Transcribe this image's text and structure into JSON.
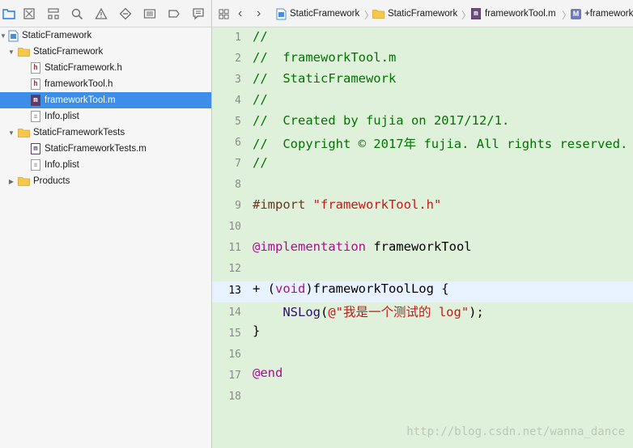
{
  "navigator": {
    "toolbar_icons": [
      "folder-icon",
      "source-control-icon",
      "hierarchy-icon",
      "search-icon",
      "warning-icon",
      "test-icon",
      "debug-icon",
      "breakpoint-icon",
      "report-icon"
    ],
    "tree": [
      {
        "label": "StaticFramework",
        "kind": "project",
        "expanded": true
      },
      {
        "label": "StaticFramework",
        "kind": "folder",
        "expanded": true
      },
      {
        "label": "StaticFramework.h",
        "kind": "h"
      },
      {
        "label": "frameworkTool.h",
        "kind": "h"
      },
      {
        "label": "frameworkTool.m",
        "kind": "m",
        "selected": true
      },
      {
        "label": "Info.plist",
        "kind": "plist"
      },
      {
        "label": "StaticFrameworkTests",
        "kind": "folder",
        "expanded": true
      },
      {
        "label": "StaticFrameworkTests.m",
        "kind": "m"
      },
      {
        "label": "Info.plist",
        "kind": "plist"
      },
      {
        "label": "Products",
        "kind": "folder",
        "expanded": false
      }
    ]
  },
  "jumpbar": {
    "items": [
      "StaticFramework",
      "StaticFramework",
      "frameworkTool.m",
      "+frameworkT"
    ]
  },
  "editor": {
    "current_line": 13,
    "line_numbers": [
      "1",
      "2",
      "3",
      "4",
      "5",
      "6",
      "7",
      "8",
      "9",
      "10",
      "11",
      "12",
      "13",
      "14",
      "15",
      "16",
      "17",
      "18"
    ],
    "lines": {
      "l1": "//",
      "l2": "//  frameworkTool.m",
      "l3": "//  StaticFramework",
      "l4": "//",
      "l5": "//  Created by fujia on 2017/12/1.",
      "l6": "//  Copyright © 2017年 fujia. All rights reserved.",
      "l7": "//",
      "l9_directive": "#import",
      "l9_string": " \"frameworkTool.h\"",
      "l11_keyword": "@implementation",
      "l11_name": " frameworkTool",
      "l13_plus": "+ (",
      "l13_type": "void",
      "l13_rest": ")frameworkToolLog {",
      "l14_indent": "    ",
      "l14_fn": "NSLog",
      "l14_paren": "(",
      "l14_string": "@\"我是一个测试的 log\"",
      "l14_end": ");",
      "l15": "}",
      "l17": "@end"
    },
    "watermark": "http://blog.csdn.net/wanna_dance"
  },
  "colors": {
    "editor_bg": "#dff1db",
    "selection": "#3d8ee8",
    "comment": "#007400",
    "keyword": "#aa0d91",
    "string": "#c41a16"
  }
}
